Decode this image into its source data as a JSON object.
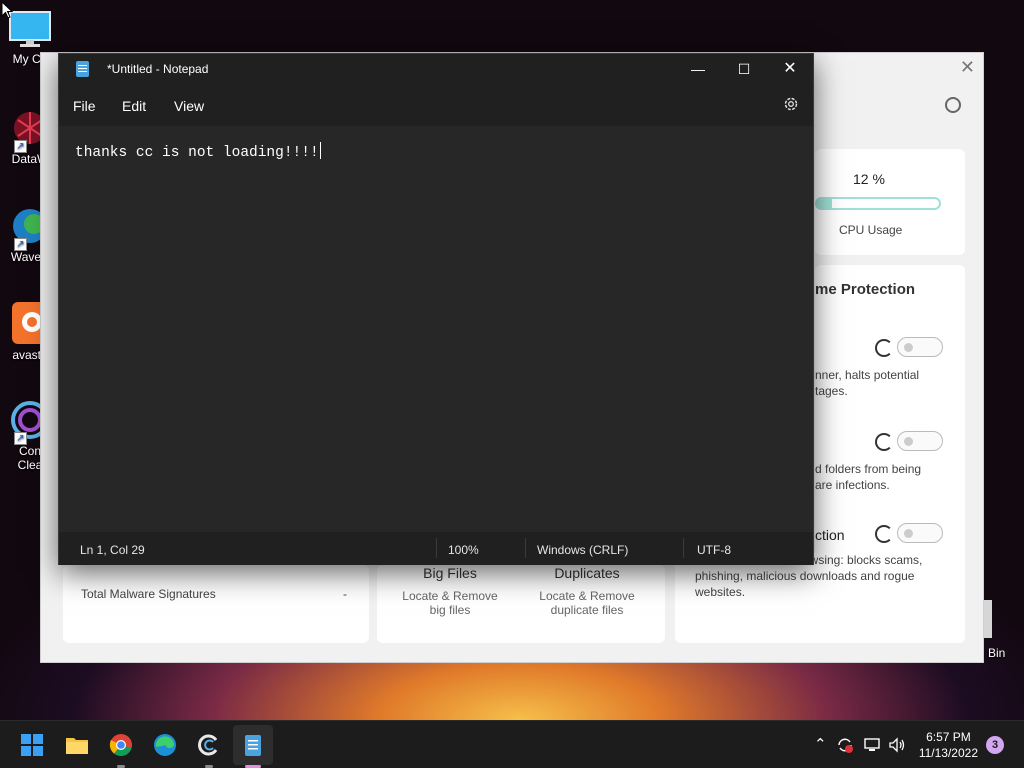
{
  "desktop": {
    "icons": [
      {
        "label": "My Co"
      },
      {
        "label": "DataW"
      },
      {
        "label": "WaveB"
      },
      {
        "label": "avast_"
      },
      {
        "label": "Con",
        "label2": "Clea"
      }
    ],
    "recycle_bin_label": "Bin"
  },
  "ccleaner": {
    "cpu_percent": "12 %",
    "cpu_value": 0.12,
    "cpu_label": "CPU Usage",
    "realtime_title": "me Protection",
    "protection_items": [
      {
        "desc_line1": "nner, halts potential",
        "desc_line2": "tages."
      },
      {
        "desc_line1": "d folders from being",
        "desc_line2": "are infections."
      },
      {
        "title_fragment": "ction",
        "desc_line1": "rowsing: blocks scams,",
        "desc_line2": "phishing, malicious downloads and rogue",
        "desc_line3": "websites."
      }
    ],
    "malware_label": "Total Malware Signatures",
    "malware_value": "-",
    "big_files": {
      "title": "Big Files",
      "line1": "Locate & Remove",
      "line2": "big files"
    },
    "duplicates": {
      "title": "Duplicates",
      "line1": "Locate & Remove",
      "line2": "duplicate files"
    }
  },
  "notepad": {
    "title": "*Untitled - Notepad",
    "menu": [
      "File",
      "Edit",
      "View"
    ],
    "content": "thanks cc is not loading!!!!",
    "status": {
      "position": "Ln 1, Col 29",
      "zoom": "100%",
      "line_ending": "Windows (CRLF)",
      "encoding": "UTF-8"
    }
  },
  "taskbar": {
    "time": "6:57 PM",
    "date": "11/13/2022",
    "notification_count": "3",
    "apps": [
      "start-icon",
      "file-explorer-icon",
      "chrome-icon",
      "edge-icon",
      "ccleaner-icon",
      "notepad-icon"
    ]
  }
}
